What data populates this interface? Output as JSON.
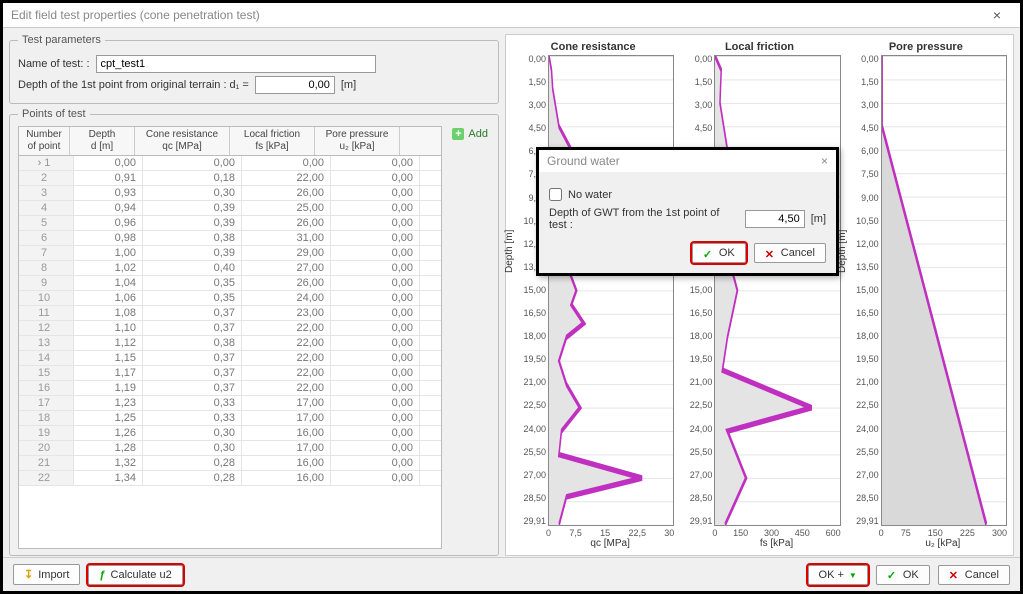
{
  "window": {
    "title": "Edit field test properties (cone penetration test)"
  },
  "test_params": {
    "legend": "Test parameters",
    "name_label": "Name of test: :",
    "name_value": "cpt_test1",
    "depth_label": "Depth of the 1st point from original terrain :  d₁ =",
    "depth_value": "0,00",
    "depth_unit": "[m]"
  },
  "points": {
    "legend": "Points of test",
    "add_label": "Add",
    "headers": {
      "num": "Number\nof point",
      "depth": "Depth\nd [m]",
      "cone": "Cone resistance\nqc [MPa]",
      "fric": "Local friction\nfs [kPa]",
      "pore": "Pore pressure\nu₂ [kPa]"
    },
    "rows": [
      {
        "n": 1,
        "d": "0,00",
        "qc": "0,00",
        "fs": "0,00",
        "u2": "0,00"
      },
      {
        "n": 2,
        "d": "0,91",
        "qc": "0,18",
        "fs": "22,00",
        "u2": "0,00"
      },
      {
        "n": 3,
        "d": "0,93",
        "qc": "0,30",
        "fs": "26,00",
        "u2": "0,00"
      },
      {
        "n": 4,
        "d": "0,94",
        "qc": "0,39",
        "fs": "25,00",
        "u2": "0,00"
      },
      {
        "n": 5,
        "d": "0,96",
        "qc": "0,39",
        "fs": "26,00",
        "u2": "0,00"
      },
      {
        "n": 6,
        "d": "0,98",
        "qc": "0,38",
        "fs": "31,00",
        "u2": "0,00"
      },
      {
        "n": 7,
        "d": "1,00",
        "qc": "0,39",
        "fs": "29,00",
        "u2": "0,00"
      },
      {
        "n": 8,
        "d": "1,02",
        "qc": "0,40",
        "fs": "27,00",
        "u2": "0,00"
      },
      {
        "n": 9,
        "d": "1,04",
        "qc": "0,35",
        "fs": "26,00",
        "u2": "0,00"
      },
      {
        "n": 10,
        "d": "1,06",
        "qc": "0,35",
        "fs": "24,00",
        "u2": "0,00"
      },
      {
        "n": 11,
        "d": "1,08",
        "qc": "0,37",
        "fs": "23,00",
        "u2": "0,00"
      },
      {
        "n": 12,
        "d": "1,10",
        "qc": "0,37",
        "fs": "22,00",
        "u2": "0,00"
      },
      {
        "n": 13,
        "d": "1,12",
        "qc": "0,38",
        "fs": "22,00",
        "u2": "0,00"
      },
      {
        "n": 14,
        "d": "1,15",
        "qc": "0,37",
        "fs": "22,00",
        "u2": "0,00"
      },
      {
        "n": 15,
        "d": "1,17",
        "qc": "0,37",
        "fs": "22,00",
        "u2": "0,00"
      },
      {
        "n": 16,
        "d": "1,19",
        "qc": "0,37",
        "fs": "22,00",
        "u2": "0,00"
      },
      {
        "n": 17,
        "d": "1,23",
        "qc": "0,33",
        "fs": "17,00",
        "u2": "0,00"
      },
      {
        "n": 18,
        "d": "1,25",
        "qc": "0,33",
        "fs": "17,00",
        "u2": "0,00"
      },
      {
        "n": 19,
        "d": "1,26",
        "qc": "0,30",
        "fs": "16,00",
        "u2": "0,00"
      },
      {
        "n": 20,
        "d": "1,28",
        "qc": "0,30",
        "fs": "17,00",
        "u2": "0,00"
      },
      {
        "n": 21,
        "d": "1,32",
        "qc": "0,28",
        "fs": "16,00",
        "u2": "0,00"
      },
      {
        "n": 22,
        "d": "1,34",
        "qc": "0,28",
        "fs": "16,00",
        "u2": "0,00"
      }
    ]
  },
  "modal": {
    "title": "Ground water",
    "no_water_label": "No water",
    "depth_label": "Depth of GWT from the 1st point of test :",
    "depth_value": "4,50",
    "depth_unit": "[m]",
    "ok": "OK",
    "cancel": "Cancel"
  },
  "footer": {
    "import": "Import",
    "calc": "Calculate u2",
    "ok_plus": "OK +",
    "ok": "OK",
    "cancel": "Cancel"
  },
  "chart_data": [
    {
      "type": "line",
      "title": "Cone resistance",
      "ylabel": "Depth [m]",
      "xlabel": "qc [MPa]",
      "y_ticks": [
        0.0,
        1.5,
        3.0,
        4.5,
        6.0,
        7.5,
        9.0,
        10.5,
        12.0,
        13.5,
        15.0,
        16.5,
        18.0,
        19.5,
        21.0,
        22.5,
        24.0,
        25.5,
        27.0,
        28.5,
        29.91
      ],
      "x_ticks": [
        0.0,
        7.5,
        15.0,
        22.5,
        30.0
      ],
      "orientation": "depth-vertical-down",
      "xlim": [
        0,
        30
      ],
      "ylim": [
        0,
        29.91
      ],
      "series": [
        {
          "name": "qc",
          "color": "#c030c0",
          "approx_values": [
            [
              0,
              0
            ],
            [
              0.9,
              0.3
            ],
            [
              2,
              0.5
            ],
            [
              4,
              2
            ],
            [
              6,
              5
            ],
            [
              8,
              3
            ],
            [
              10,
              1.5
            ],
            [
              12,
              2
            ],
            [
              13.5,
              4
            ],
            [
              15,
              6
            ],
            [
              16,
              5
            ],
            [
              17,
              8
            ],
            [
              18,
              4
            ],
            [
              19.5,
              2
            ],
            [
              21,
              4
            ],
            [
              22.5,
              7
            ],
            [
              24,
              3
            ],
            [
              25.5,
              2
            ],
            [
              27,
              22
            ],
            [
              28,
              4
            ],
            [
              29.9,
              2
            ]
          ]
        }
      ]
    },
    {
      "type": "line",
      "title": "Local friction",
      "ylabel": "Depth [m]",
      "xlabel": "fs [kPa]",
      "y_ticks": [
        0.0,
        1.5,
        3.0,
        4.5,
        6.0,
        7.5,
        9.0,
        10.5,
        12.0,
        13.5,
        15.0,
        16.5,
        18.0,
        19.5,
        21.0,
        22.5,
        24.0,
        25.5,
        27.0,
        28.5,
        29.91
      ],
      "x_ticks": [
        0,
        150,
        300,
        450,
        600
      ],
      "orientation": "depth-vertical-down",
      "xlim": [
        0,
        600
      ],
      "ylim": [
        0,
        29.91
      ],
      "series": [
        {
          "name": "fs",
          "color": "#c030c0",
          "approx_values": [
            [
              0,
              0
            ],
            [
              1,
              25
            ],
            [
              3,
              20
            ],
            [
              6,
              60
            ],
            [
              9,
              30
            ],
            [
              12,
              40
            ],
            [
              15,
              100
            ],
            [
              18,
              60
            ],
            [
              20,
              30
            ],
            [
              22.5,
              450
            ],
            [
              24,
              60
            ],
            [
              27,
              150
            ],
            [
              29.9,
              40
            ]
          ]
        }
      ]
    },
    {
      "type": "line",
      "title": "Pore pressure",
      "ylabel": "Depth [m]",
      "xlabel": "u₂ [kPa]",
      "y_ticks": [
        0.0,
        1.5,
        3.0,
        4.5,
        6.0,
        7.5,
        9.0,
        10.5,
        12.0,
        13.5,
        15.0,
        16.5,
        18.0,
        19.5,
        21.0,
        22.5,
        24.0,
        25.5,
        27.0,
        28.5,
        29.91
      ],
      "x_ticks": [
        0,
        75,
        150,
        225,
        300
      ],
      "orientation": "depth-vertical-down",
      "xlim": [
        0,
        300
      ],
      "ylim": [
        0,
        29.91
      ],
      "series": [
        {
          "name": "u2",
          "color": "#c030c0",
          "approx_values": [
            [
              0,
              0
            ],
            [
              4.5,
              0
            ],
            [
              29.91,
              250
            ]
          ]
        }
      ]
    }
  ]
}
